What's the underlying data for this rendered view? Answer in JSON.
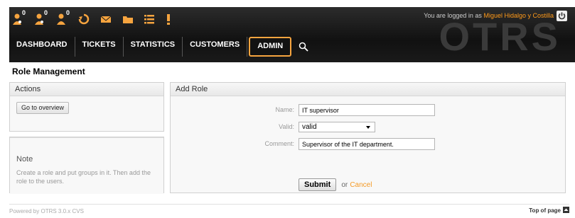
{
  "header": {
    "logo": "OTRS",
    "counts": [
      "0",
      "0",
      "0"
    ],
    "login_prefix": "You are logged in as",
    "user_name": "Miguel Hidalgo y Costilla"
  },
  "nav": {
    "items": [
      {
        "label": "DASHBOARD"
      },
      {
        "label": "TICKETS"
      },
      {
        "label": "STATISTICS"
      },
      {
        "label": "CUSTOMERS"
      },
      {
        "label": "ADMIN"
      }
    ]
  },
  "page": {
    "title": "Role Management"
  },
  "actions": {
    "header": "Actions",
    "overview_label": "Go to overview"
  },
  "note": {
    "title": "Note",
    "text": "Create a role and put groups in it. Then add the role to the users."
  },
  "form": {
    "header": "Add Role",
    "name_label": "Name:",
    "name_value": "IT supervisor",
    "valid_label": "Valid:",
    "valid_value": "valid",
    "comment_label": "Comment:",
    "comment_value": "Supervisor of the IT department.",
    "submit_label": "Submit",
    "or_text": "or",
    "cancel_label": "Cancel"
  },
  "footer": {
    "powered": "Powered by OTRS 3.0.x CVS",
    "top_label": "Top of page"
  },
  "colors": {
    "accent": "#f6a43f",
    "header_bg": "#1a1a1a"
  }
}
